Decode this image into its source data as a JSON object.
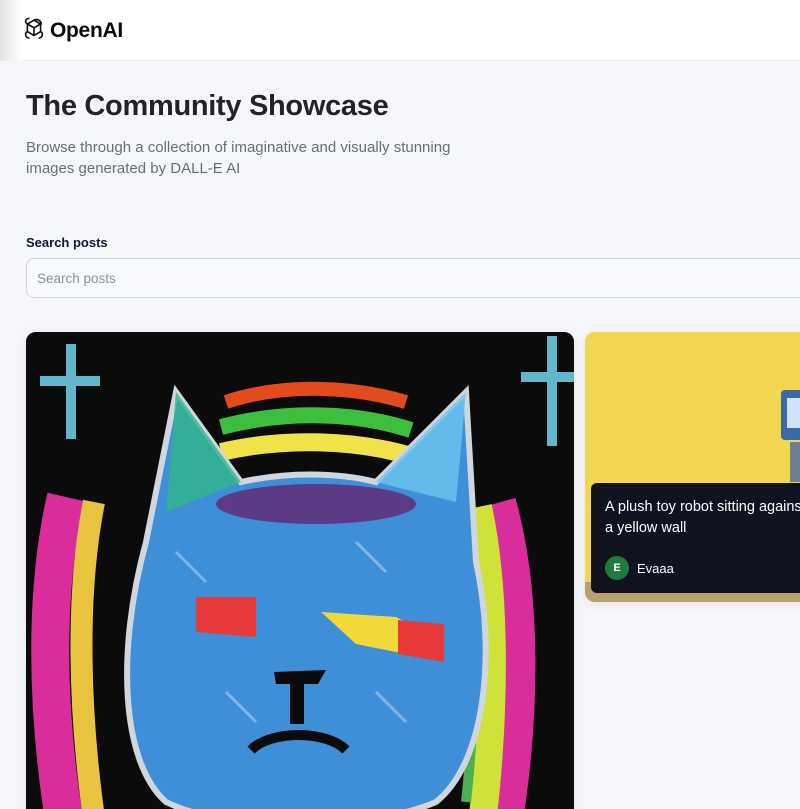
{
  "header": {
    "brand": "OpenAI"
  },
  "hero": {
    "title": "The Community Showcase",
    "subtitle": "Browse through a collection of imaginative and visually stunning images generated by DALL-E AI"
  },
  "search": {
    "label": "Search posts",
    "placeholder": "Search posts",
    "value": ""
  },
  "posts": [
    {
      "image": "pastel-cat-astronaut-drawing"
    },
    {
      "image": "plush-robot-yellow-wall",
      "prompt": "A plush toy robot sitting against a yellow wall",
      "author": {
        "initial": "E",
        "name": "Evaaa"
      }
    }
  ],
  "colors": {
    "accent": "#1f7a3f",
    "overlay": "#10131f",
    "page_bg": "#f6f7fb"
  },
  "icons": {
    "logo": "openai-logo-icon"
  }
}
